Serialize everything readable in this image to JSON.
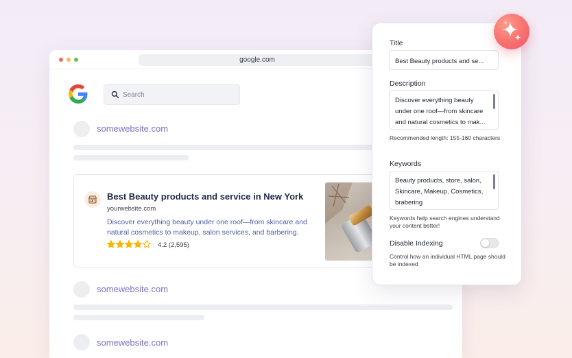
{
  "browser": {
    "url": "google.com",
    "search": {
      "placeholder": "Search"
    }
  },
  "results": [
    {
      "site": "somewebsite.com"
    },
    {
      "site": "somewebsite.com"
    },
    {
      "site": "somewebsite.com"
    }
  ],
  "featured": {
    "title": "Best Beauty products and service in New York",
    "url": "yourwebsite.com",
    "description": "Discover everything beauty under one roof—from skincare and natural cosmetics to makeup, salon services, and barbering.",
    "rating": 4.2,
    "rating_text": "4.2 (2,595)",
    "stars_filled": 4,
    "stars_total": 5
  },
  "panel": {
    "title_label": "Title",
    "title_value": "Best Beauty products and se...",
    "description_label": "Description",
    "description_value": "Discover everything beauty under one roof—from skincare and natural cosmetics to mak...",
    "description_helper": "Recommended length: 155-160 characters",
    "keywords_label": "Keywords",
    "keywords_value": "Beauty products, store, salon, Skincare, Makeup, Cosmetics, brabering",
    "keywords_helper": "Keywords help search engines understand your content better!",
    "indexing_label": "Disable Indexing",
    "indexing_enabled": false,
    "indexing_helper": "Control how an individual HTML page should be indexed"
  },
  "colors": {
    "link": "#7b72c9",
    "star": "#f5b800",
    "badge": "#f7706f"
  },
  "icons": {
    "badge": "sparkle-icon",
    "search": "search-icon",
    "brand": "storefront-icon"
  }
}
